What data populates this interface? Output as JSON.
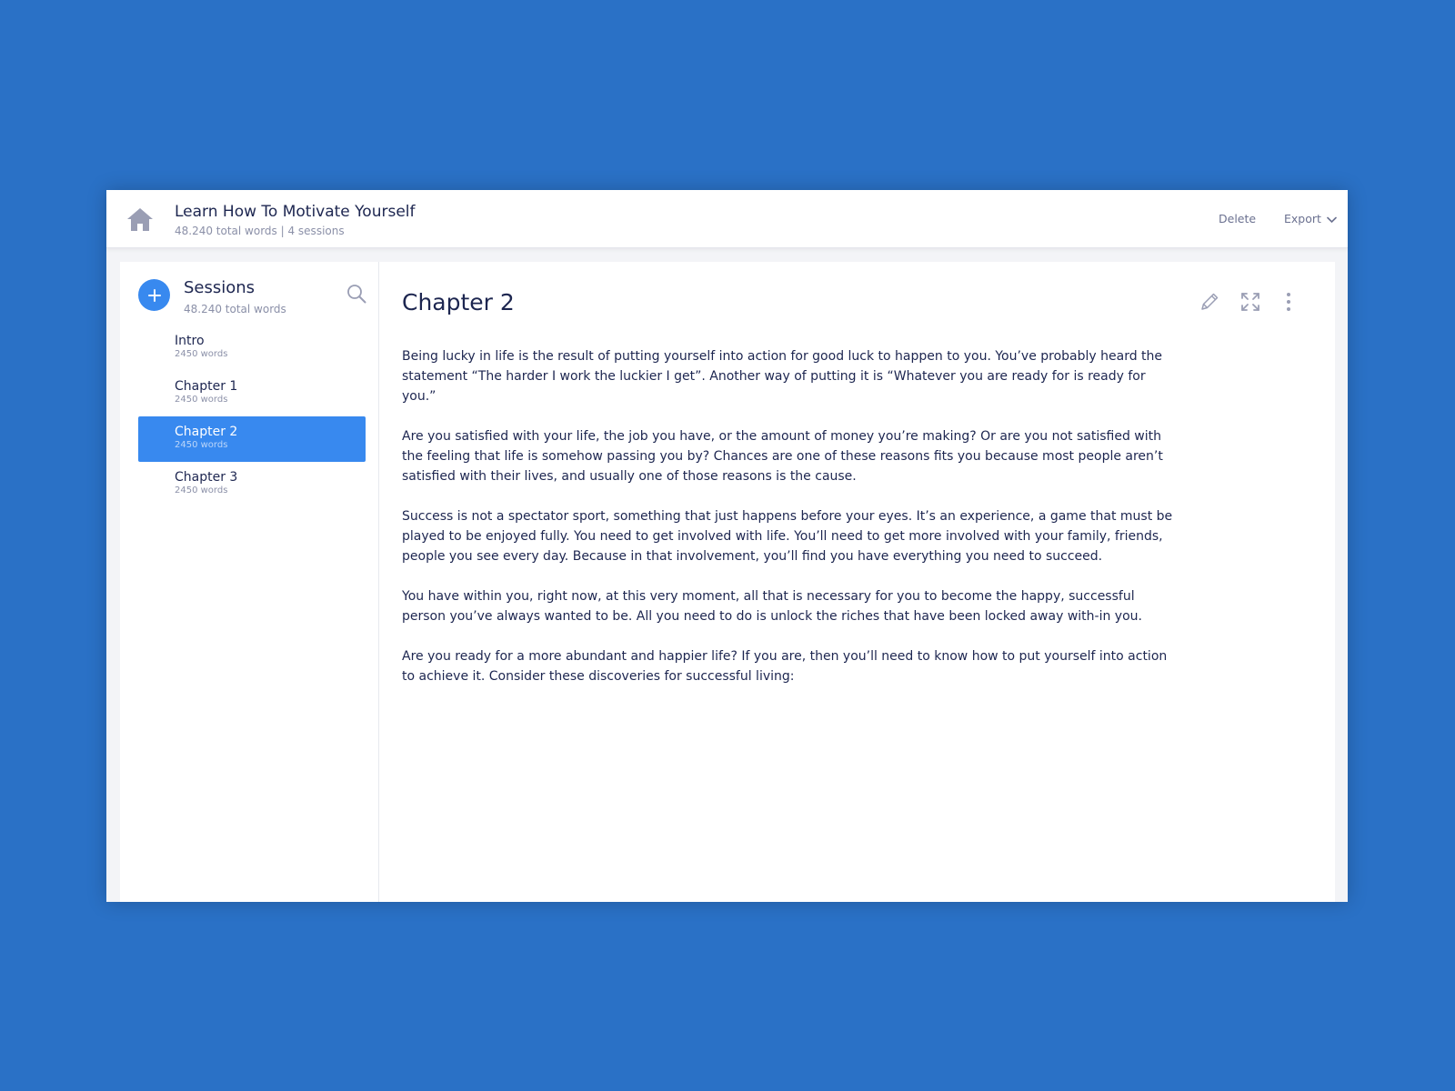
{
  "header": {
    "title": "Learn How To Motivate Yourself",
    "subtitle": "48.240 total words | 4 sessions",
    "delete_label": "Delete",
    "export_label": "Export",
    "home_icon": "home-icon",
    "export_icon": "chevron-down-icon"
  },
  "sidebar": {
    "title": "Sessions",
    "subtitle": "48.240 total words",
    "add_icon": "plus-icon",
    "search_icon": "search-icon",
    "items": [
      {
        "name": "Intro",
        "words": "2450 words",
        "active": false
      },
      {
        "name": "Chapter 1",
        "words": "2450 words",
        "active": false
      },
      {
        "name": "Chapter 2",
        "words": "2450 words",
        "active": true
      },
      {
        "name": "Chapter 3",
        "words": "2450 words",
        "active": false
      }
    ]
  },
  "content": {
    "title": "Chapter 2",
    "tools": [
      "pencil-icon",
      "expand-icon",
      "more-vertical-icon"
    ],
    "paragraphs": [
      "Being lucky in life is the result of putting yourself into action for good luck to happen to you. You’ve probably heard the statement “The harder I work the luckier I get”. Another way of putting it is “Whatever you are ready for is ready for you.”",
      "Are you satisfied with your life, the job you have, or the amount of money you’re making? Or are you not satisfied with the feeling that life is somehow passing you by? Chances are one of these reasons fits you because most people aren’t satisfied with their lives, and usually one of those reasons is the cause.",
      "Success is not a spectator sport, something that just happens before your eyes. It’s an experience, a game that must be played to be enjoyed fully. You need to get involved with life. You’ll need to get more involved with your family, friends, people you see every day. Because in that involvement, you’ll find you have everything you need to succeed.",
      "You have within you, right now, at this very moment, all that is necessary for you to become the happy, successful person you’ve always wanted to be. All you need to do is unlock the riches that have been locked away with-in you.",
      "Are you ready for a more abundant and happier life? If you are, then you’ll need to know how to put yourself into action to achieve it. Consider these discoveries for successful living:"
    ]
  },
  "colors": {
    "background": "#2a71c6",
    "accent": "#3889ef",
    "text": "#1d2650",
    "muted": "#8b90a8"
  }
}
